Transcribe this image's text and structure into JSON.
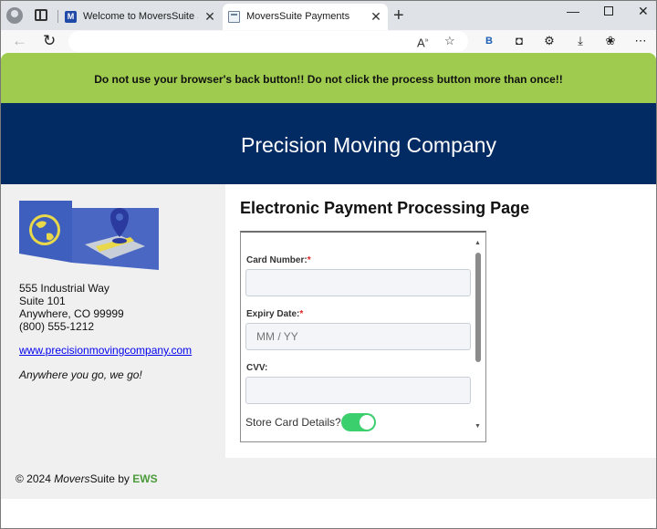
{
  "browser": {
    "tabs": [
      {
        "label": "Welcome to MoversSuite Software",
        "favicon": "M"
      },
      {
        "label": "MoversSuite Payments"
      }
    ],
    "address_url": ""
  },
  "page": {
    "warning": "Do not use your browser's back button!! Do not click the process button more than once!!",
    "company_name": "Precision Moving Company",
    "sidebar": {
      "address_lines": [
        "555 Industrial Way",
        "Suite 101",
        "Anywhere, CO 99999",
        "(800) 555-1212"
      ],
      "website": "www.precisionmovingcompany.com",
      "tagline": "Anywhere you go, we go!"
    },
    "main": {
      "title": "Electronic Payment Processing Page",
      "form": {
        "card_number": {
          "label": "Card Number:",
          "required_mark": "*",
          "value": ""
        },
        "expiry": {
          "label": "Expiry Date:",
          "required_mark": "*",
          "placeholder": "MM / YY"
        },
        "cvv": {
          "label": "CVV:",
          "value": ""
        },
        "store_card": {
          "label": "Store Card Details?",
          "enabled": true
        }
      }
    },
    "footer": {
      "prefix": "© 2024 ",
      "brand_italic": "Movers",
      "brand_rest": "Suite",
      "by": " by ",
      "company": "EWS"
    }
  },
  "colors": {
    "warning_bg": "#9fcc4f",
    "banner_bg": "#032b63",
    "toggle_on": "#3ccf6e",
    "link": "#0000ee",
    "ews_green": "#4b9a3a"
  }
}
